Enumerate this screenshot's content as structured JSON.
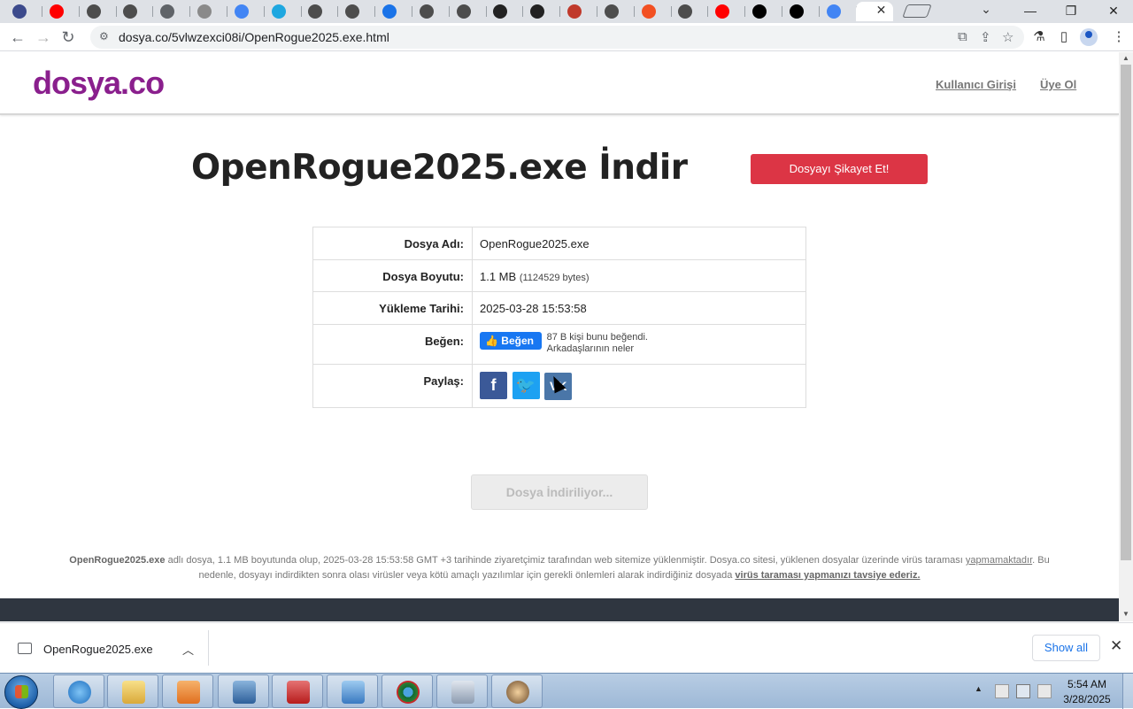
{
  "browser": {
    "tabs": [
      {
        "icon": "globe-icon",
        "color": "#3c4a8c"
      },
      {
        "icon": "youtube-icon",
        "color": "#ff0000"
      },
      {
        "icon": "globe-icon",
        "color": "#4d4d4d"
      },
      {
        "icon": "globe-icon",
        "color": "#4d4d4d"
      },
      {
        "icon": "cloud-icon",
        "color": "#5f6368"
      },
      {
        "icon": "document-icon",
        "color": "#8a8a8a"
      },
      {
        "icon": "google-icon",
        "color": "#4285f4"
      },
      {
        "icon": "download-arrow-icon",
        "color": "#1ea7e0"
      },
      {
        "icon": "globe-icon",
        "color": "#4d4d4d"
      },
      {
        "icon": "globe-icon",
        "color": "#4d4d4d"
      },
      {
        "icon": "download-icon",
        "color": "#1a73e8"
      },
      {
        "icon": "globe-icon",
        "color": "#4d4d4d"
      },
      {
        "icon": "globe-icon",
        "color": "#4d4d4d"
      },
      {
        "icon": "app-icon",
        "color": "#222222"
      },
      {
        "icon": "columns-icon",
        "color": "#222222"
      },
      {
        "icon": "person-icon",
        "color": "#c0392b"
      },
      {
        "icon": "globe-icon",
        "color": "#4d4d4d"
      },
      {
        "icon": "microsoft-icon",
        "color": "#f25022"
      },
      {
        "icon": "globe-icon",
        "color": "#4d4d4d"
      },
      {
        "icon": "youtube-icon",
        "color": "#ff0000"
      },
      {
        "icon": "github-icon",
        "color": "#000000"
      },
      {
        "icon": "github-icon",
        "color": "#000000"
      },
      {
        "icon": "google-icon",
        "color": "#4285f4"
      },
      {
        "icon": "active-tab-icon",
        "color": "#ffffff"
      }
    ],
    "address": "dosya.co/5vlwzexci08i/OpenRogue2025.exe.html"
  },
  "site": {
    "logo": "dosya.co",
    "login_link": "Kullanıcı Girişi",
    "signup_link": "Üye Ol"
  },
  "file": {
    "title": "OpenRogue2025.exe İndir",
    "report_button": "Dosyayı Şikayet Et!",
    "rows": {
      "name_label": "Dosya Adı:",
      "name_value": "OpenRogue2025.exe",
      "size_label": "Dosya Boyutu:",
      "size_value": "1.1 MB",
      "size_bytes": "(1124529 bytes)",
      "date_label": "Yükleme Tarihi:",
      "date_value": "2025-03-28 15:53:58",
      "like_label": "Beğen:",
      "like_button": "Beğen",
      "like_text_1": "87 B kişi bunu beğendi.",
      "like_text_2": "Arkadaşlarının neler",
      "share_label": "Paylaş:"
    },
    "download_button": "Dosya İndiriliyor..."
  },
  "disclaimer": {
    "filename": "OpenRogue2025.exe",
    "text_1": " adlı dosya, 1.1 MB boyutunda olup, 2025-03-28 15:53:58 GMT +3 tarihinde ziyaretçimiz tarafından web sitemize yüklenmiştir. Dosya.co sitesi, yüklenen dosyalar üzerinde virüs taraması ",
    "link_1": "yapmamaktadır",
    "text_2": ". Bu nedenle, dosyayı indirdikten sonra olası virüsler veya kötü amaçlı yazılımlar için gerekli önlemleri alarak indirdiğiniz dosyada ",
    "link_2": "virüs taraması yapmanızı tavsiye ederiz."
  },
  "download_bar": {
    "filename": "OpenRogue2025.exe",
    "show_all": "Show all"
  },
  "taskbar": {
    "time": "5:54 AM",
    "date": "3/28/2025"
  }
}
